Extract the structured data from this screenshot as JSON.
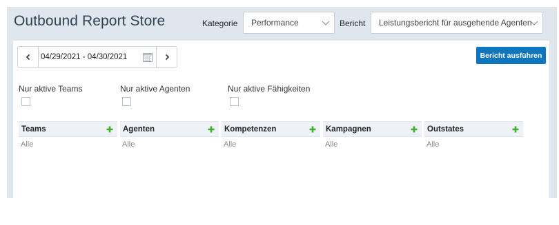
{
  "header": {
    "title": "Outbound Report Store",
    "category_label": "Kategorie",
    "category_value": "Performance",
    "report_label": "Bericht",
    "report_value": "Leistungsbericht für ausgehende Agenten"
  },
  "toolbar": {
    "date_range": "04/29/2021 - 04/30/2021",
    "run_label": "Bericht ausführen"
  },
  "checkboxes": [
    {
      "label": "Nur aktive Teams",
      "checked": false
    },
    {
      "label": "Nur aktive Agenten",
      "checked": false
    },
    {
      "label": "Nur aktive Fähigkeiten",
      "checked": false
    }
  ],
  "columns": [
    {
      "header": "Teams",
      "value": "Alle"
    },
    {
      "header": "Agenten",
      "value": "Alle"
    },
    {
      "header": "Kompetenzen",
      "value": "Alle"
    },
    {
      "header": "Kampagnen",
      "value": "Alle"
    },
    {
      "header": "Outstates",
      "value": "Alle"
    }
  ],
  "colors": {
    "header_bg": "#dfe6ee",
    "run_button": "#0f75bc",
    "plus_icon": "#3fae2a"
  },
  "icons": [
    "chevron-down-icon",
    "chevron-left-icon",
    "chevron-right-icon",
    "calendar-icon",
    "plus-icon"
  ]
}
